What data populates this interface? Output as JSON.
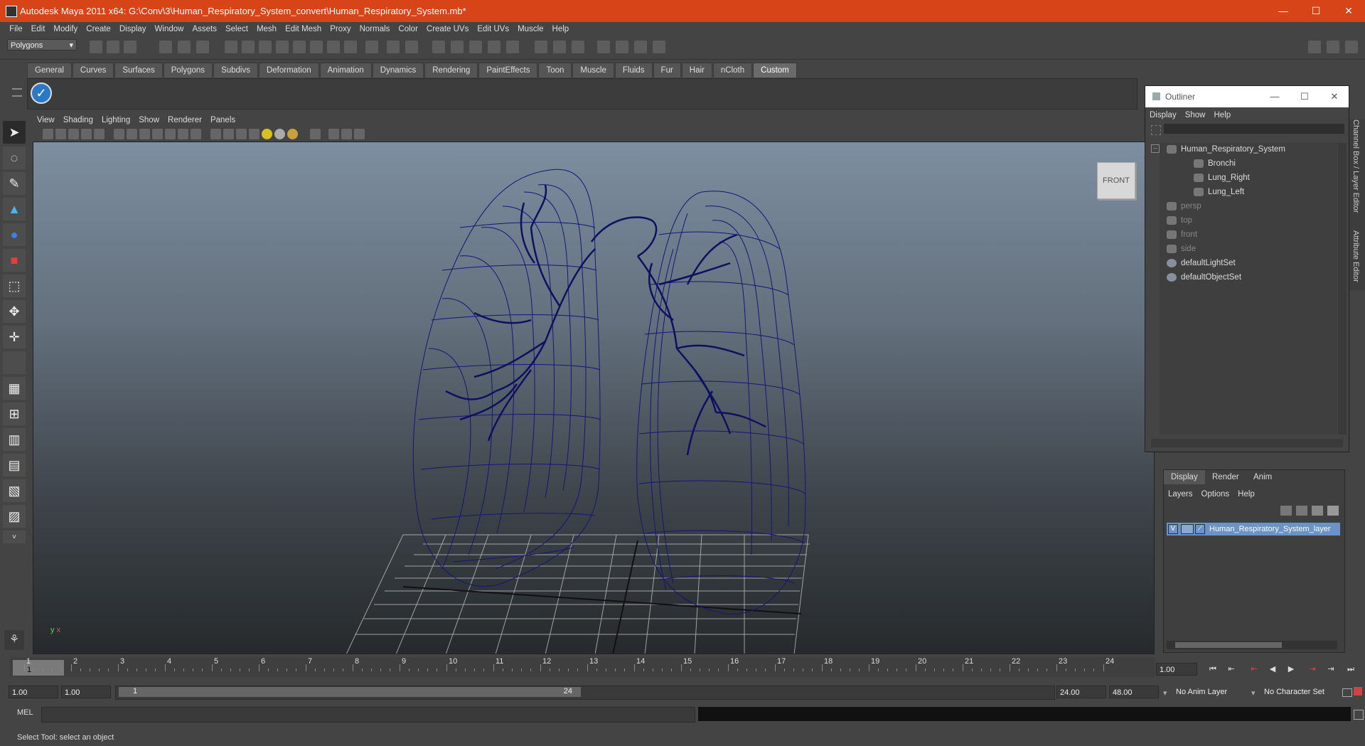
{
  "window": {
    "title": "Autodesk Maya 2011 x64: G:\\Conv\\3\\Human_Respiratory_System_convert\\Human_Respiratory_System.mb*",
    "minimize": "—",
    "maximize": "☐",
    "close": "✕"
  },
  "menubar": [
    "File",
    "Edit",
    "Modify",
    "Create",
    "Display",
    "Window",
    "Assets",
    "Select",
    "Mesh",
    "Edit Mesh",
    "Proxy",
    "Normals",
    "Color",
    "Create UVs",
    "Edit UVs",
    "Muscle",
    "Help"
  ],
  "status_line": {
    "mode": "Polygons"
  },
  "shelf_tabs": [
    "General",
    "Curves",
    "Surfaces",
    "Polygons",
    "Subdivs",
    "Deformation",
    "Animation",
    "Dynamics",
    "Rendering",
    "PaintEffects",
    "Toon",
    "Muscle",
    "Fluids",
    "Fur",
    "Hair",
    "nCloth",
    "Custom"
  ],
  "shelf_active": "Custom",
  "viewport": {
    "menu": [
      "View",
      "Shading",
      "Lighting",
      "Show",
      "Renderer",
      "Panels"
    ],
    "viewcube_label": "FRONT",
    "axis_y": "y",
    "axis_x": "x"
  },
  "outliner": {
    "title": "Outliner",
    "menu": [
      "Display",
      "Show",
      "Help"
    ],
    "items": [
      {
        "label": "Human_Respiratory_System",
        "depth": 0,
        "dim": false
      },
      {
        "label": "Bronchi",
        "depth": 1,
        "dim": false
      },
      {
        "label": "Lung_Right",
        "depth": 1,
        "dim": false
      },
      {
        "label": "Lung_Left",
        "depth": 1,
        "dim": false
      },
      {
        "label": "persp",
        "depth": 0,
        "dim": true
      },
      {
        "label": "top",
        "depth": 0,
        "dim": true
      },
      {
        "label": "front",
        "depth": 0,
        "dim": true
      },
      {
        "label": "side",
        "depth": 0,
        "dim": true
      },
      {
        "label": "defaultLightSet",
        "depth": 0,
        "dim": false
      },
      {
        "label": "defaultObjectSet",
        "depth": 0,
        "dim": false
      }
    ]
  },
  "side_tabs": {
    "channel_box": "Channel Box / Layer Editor",
    "attribute_editor": "Attribute Editor"
  },
  "layer_editor": {
    "tabs": [
      "Display",
      "Render",
      "Anim"
    ],
    "menu": [
      "Layers",
      "Options",
      "Help"
    ],
    "layer": {
      "visible": "V",
      "name": "Human_Respiratory_System_layer"
    }
  },
  "time_slider": {
    "ticks": [
      "1",
      "2",
      "3",
      "4",
      "5",
      "6",
      "7",
      "8",
      "9",
      "10",
      "11",
      "12",
      "13",
      "14",
      "15",
      "16",
      "17",
      "18",
      "19",
      "20",
      "21",
      "22",
      "23",
      "24"
    ],
    "current_frame": "1",
    "current_time": "1.00"
  },
  "range_slider": {
    "start": "1.00",
    "start_inner": "1.00",
    "range_left": "1",
    "range_right": "24",
    "end_inner": "24.00",
    "end": "48.00",
    "anim_layer": "No Anim Layer",
    "character_set": "No Character Set"
  },
  "command_line": {
    "label": "MEL"
  },
  "help_line": "Select Tool: select an object"
}
